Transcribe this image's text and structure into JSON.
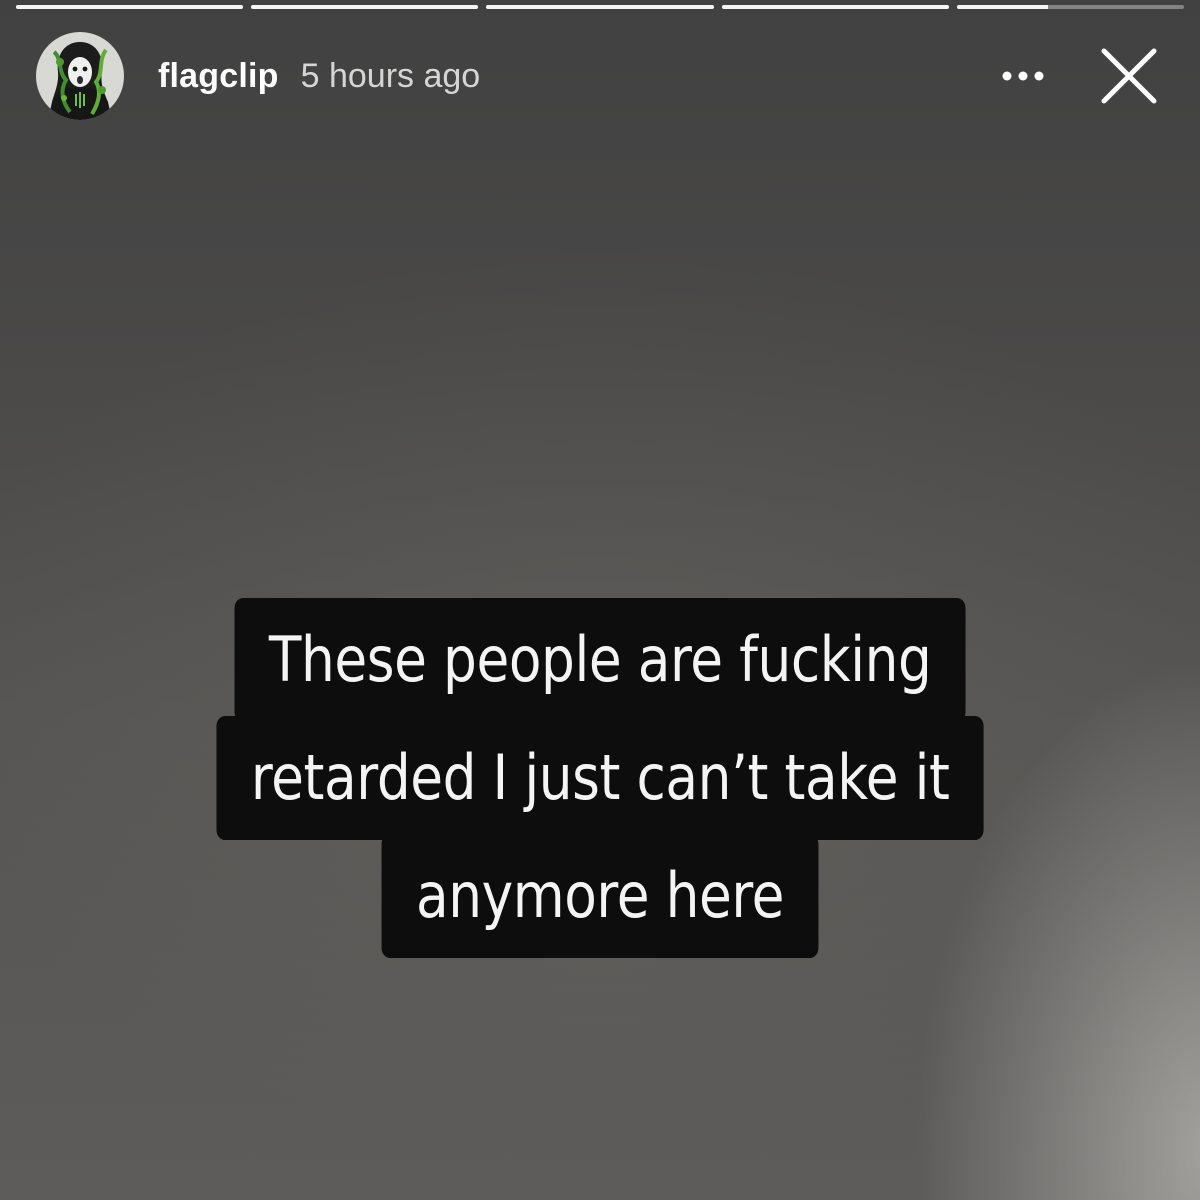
{
  "story": {
    "progress_segments": [
      1,
      1,
      1,
      1,
      0.4
    ],
    "user": {
      "username": "flagclip",
      "time_ago": "5 hours ago",
      "avatar_icon": "profile-avatar"
    },
    "controls": {
      "more_icon": "more-dots-icon",
      "close_icon": "close-icon"
    },
    "caption_lines": [
      "These people are fucking",
      "retarded I just can’t take it",
      "anymore here"
    ]
  }
}
